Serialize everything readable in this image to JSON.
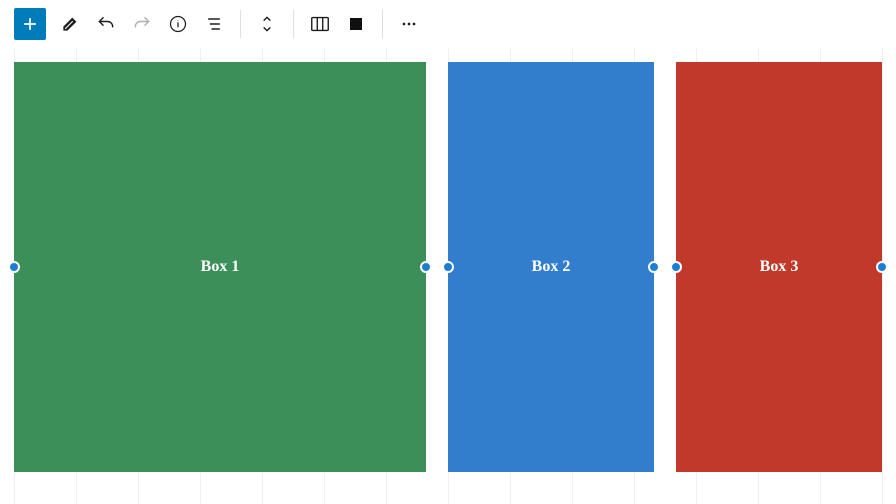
{
  "toolbar": {
    "inserter_label": "Add block",
    "tools_label": "Tools",
    "undo_label": "Undo",
    "redo_label": "Redo",
    "info_label": "Details",
    "outline_label": "Document outline",
    "move_label": "Move up/down",
    "columns_label": "Select Columns",
    "color_label": "Color",
    "more_label": "Options"
  },
  "canvas": {
    "boxes": [
      {
        "label": "Box 1",
        "color": "#3c8f59"
      },
      {
        "label": "Box 2",
        "color": "#327dcc"
      },
      {
        "label": "Box 3",
        "color": "#c0392b"
      }
    ],
    "ruler_ticks": 14
  }
}
